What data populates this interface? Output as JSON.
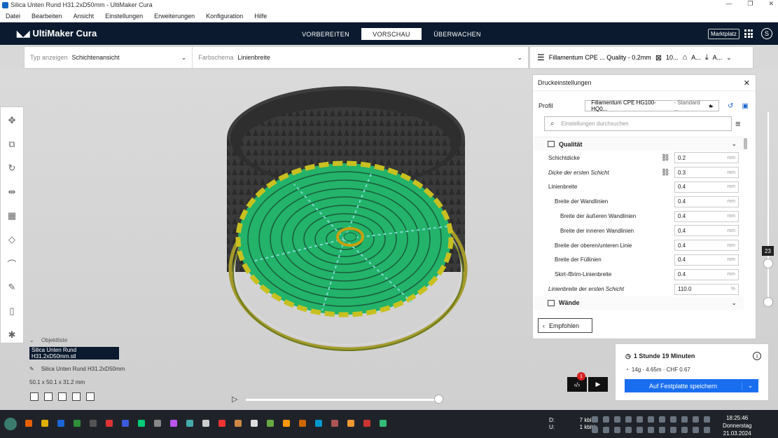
{
  "window": {
    "title": "Silica Unten Rund H31.2xD50mm - UltiMaker Cura",
    "controls": [
      "—",
      "❐",
      "✕"
    ]
  },
  "menu": [
    "Datei",
    "Bearbeiten",
    "Ansicht",
    "Einstellungen",
    "Erweiterungen",
    "Konfiguration",
    "Hilfe"
  ],
  "header": {
    "logo": "UltiMaker Cura",
    "stages": [
      "VORBEREITEN",
      "VORSCHAU",
      "ÜBERWACHEN"
    ],
    "active_stage": "VORSCHAU",
    "marketplace": "Marktplatz",
    "account_initial": "S"
  },
  "viewbar": {
    "type_label": "Typ anzeigen",
    "type_value": "Schichtenansicht",
    "color_label": "Farbschema",
    "color_value": "Linienbreite"
  },
  "printbar": {
    "profile_summary": "Fillamentum CPE ... Quality - 0.2mm",
    "support": "10...",
    "adhesion": "A...",
    "output": "A..."
  },
  "settings": {
    "title": "Druckeinstellungen",
    "profile_label": "Profil",
    "profile_value": "Fillamentum CPE HG100-HQ0...",
    "profile_std": "- Standard ...",
    "search_placeholder": "Einstellungen durchsuchen",
    "section_quality": "Qualität",
    "section_walls": "Wände",
    "rows": [
      {
        "name": "Schichtdicke",
        "value": "0.2",
        "unit": "mm",
        "level": 0,
        "link": true,
        "italic": false
      },
      {
        "name": "Dicke der ersten Schicht",
        "value": "0.3",
        "unit": "mm",
        "level": 0,
        "link": true,
        "italic": true
      },
      {
        "name": "Linienbreite",
        "value": "0.4",
        "unit": "mm",
        "level": 0,
        "link": false,
        "italic": false
      },
      {
        "name": "Breite der Wandlinien",
        "value": "0.4",
        "unit": "mm",
        "level": 1,
        "link": false,
        "italic": false
      },
      {
        "name": "Breite der äußeren Wandlinien",
        "value": "0.4",
        "unit": "mm",
        "level": 2,
        "link": false,
        "italic": false
      },
      {
        "name": "Breite der inneren Wandlinien",
        "value": "0.4",
        "unit": "mm",
        "level": 2,
        "link": false,
        "italic": false
      },
      {
        "name": "Breite der oberen/unteren Linie",
        "value": "0.4",
        "unit": "mm",
        "level": 1,
        "link": false,
        "italic": false
      },
      {
        "name": "Breite der Füllinien",
        "value": "0.4",
        "unit": "mm",
        "level": 1,
        "link": false,
        "italic": false
      },
      {
        "name": "Skirt-/Brim-Linienbreite",
        "value": "0.4",
        "unit": "mm",
        "level": 1,
        "link": false,
        "italic": false
      },
      {
        "name": "Linienbreite der ersten Schicht",
        "value": "110.0",
        "unit": "%",
        "level": 0,
        "link": false,
        "italic": true
      }
    ],
    "recommended": "Empfohlen"
  },
  "objects": {
    "list_label": "Objektliste",
    "file": "Silica Unten Rund H31.2xD50mm.stl",
    "name": "Silica Unten Rund H31.2xD50mm",
    "dims": "50.1 x 50.1 x 31.2 mm"
  },
  "layer": {
    "current": "23"
  },
  "output": {
    "time": "1 Stunde 19 Minuten",
    "material": "14g · 4.65m · CHF 0.67",
    "save": "Auf Festplatte speichern",
    "notification_count": "1"
  },
  "taskbar": {
    "down_label": "D:",
    "down_value": "7 kbit/s",
    "up_label": "U:",
    "up_value": "1 kbit/s",
    "time": "18:25:46",
    "day": "Donnerstag",
    "date": "21.03.2024",
    "app_icon_colors": [
      "#e66000",
      "#e0b000",
      "#1a66d6",
      "#2f8f3a",
      "#555",
      "#d33",
      "#3b5bdb",
      "#0c7",
      "#888",
      "#b5e",
      "#4aa",
      "#ccc",
      "#e33",
      "#c84",
      "#ddd",
      "#6a4",
      "#f90",
      "#c60",
      "#09c",
      "#a55",
      "#e93",
      "#c33",
      "#3b7"
    ]
  }
}
